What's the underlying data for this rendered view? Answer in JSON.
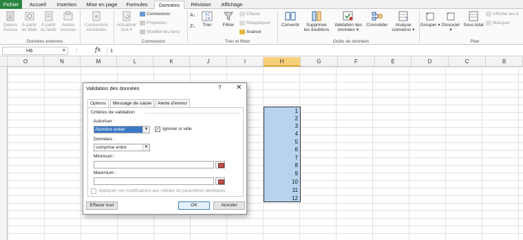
{
  "tabs": [
    "Fichier",
    "Accueil",
    "Insertion",
    "Mise en page",
    "Formules",
    "Données",
    "Révision",
    "Affichage"
  ],
  "ribbon": {
    "external": {
      "buttons": [
        [
          "Depuis",
          "Access"
        ],
        [
          "À partir",
          "du Web"
        ],
        [
          "À partir",
          "du texte"
        ],
        [
          "Autres",
          "sources"
        ]
      ],
      "existing": [
        "Connexions",
        "existantes"
      ],
      "label": "Données externes"
    },
    "connections": {
      "refresh": [
        "Actualiser",
        "tout"
      ],
      "items": [
        "Connexions",
        "Propriétés",
        "Modifier les liens"
      ],
      "label": "Connexions"
    },
    "sort": {
      "sort_btn": "Trier",
      "filter_btn": "Filtrer",
      "items": [
        "Effacer",
        "Réappliquer",
        "Avancé"
      ],
      "label": "Trier et filtrer"
    },
    "tools": {
      "buttons": [
        [
          "Convertir",
          ""
        ],
        [
          "Supprimer",
          "les doublons"
        ],
        [
          "Validation des",
          "données"
        ],
        [
          "Consolider",
          ""
        ],
        [
          "Analyse",
          "scénarios"
        ]
      ],
      "label": "Outils de données"
    },
    "outline": {
      "buttons": [
        "Grouper",
        "Dissocier",
        "Sous-total"
      ],
      "items": [
        "Afficher les d",
        "Masquer"
      ],
      "label": "Plan"
    }
  },
  "formula_bar": {
    "name_box": "H6",
    "fx": "fx",
    "value": "1"
  },
  "columns": [
    "O",
    "N",
    "M",
    "L",
    "K",
    "J",
    "I",
    "H",
    "G",
    "F",
    "E",
    "D",
    "C",
    "B"
  ],
  "cells": [
    "1",
    "2",
    "3",
    "4",
    "5",
    "6",
    "7",
    "8",
    "9",
    "10",
    "11",
    "12"
  ],
  "dialog": {
    "title": "Validation des données",
    "help": "?",
    "close": "✕",
    "tabs": [
      "Options",
      "Message de saisie",
      "Alerte d'erreur"
    ],
    "section": "Critères de validation",
    "allow_label": "Autoriser :",
    "allow_value": "Nombre entier",
    "ignore_blank": "Ignorer si vide",
    "data_label": "Données :",
    "data_value": "comprise entre",
    "min_label": "Minimum :",
    "max_label": "Maximum :",
    "apply_all": "Appliquer ces modifications aux cellules de paramètres identiques",
    "clear_all": "Effacer tout",
    "ok": "OK",
    "cancel": "Annuler"
  },
  "colors": {
    "file_tab": "#2a8540",
    "selection": "#b7d3ee",
    "col_header_sel": "#f9d07a"
  }
}
